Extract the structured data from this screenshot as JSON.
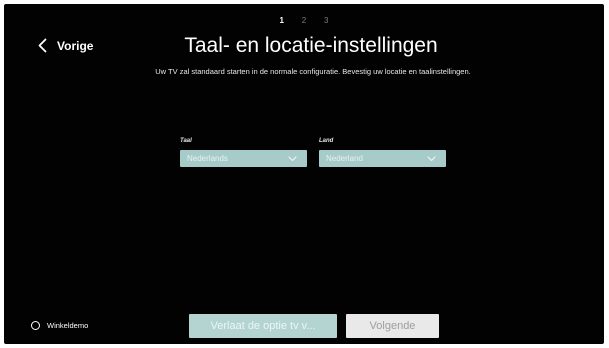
{
  "steps": {
    "items": [
      "1",
      "2",
      "3"
    ],
    "active_index": 0
  },
  "back": {
    "label": "Vorige",
    "icon": "chevron-left-icon"
  },
  "header": {
    "title": "Taal- en locatie-instellingen",
    "subtitle": "Uw TV zal standaard starten in de normale configuratie. Bevestig uw locatie en taalinstellingen."
  },
  "fields": {
    "taal": {
      "label": "Taal",
      "value": "Nederlands",
      "icon": "chevron-down-icon"
    },
    "land": {
      "label": "Land",
      "value": "Nederland",
      "icon": "chevron-down-icon"
    }
  },
  "footer": {
    "demo_label": "Winkeldemo",
    "exit_label": "Verlaat de optie tv v...",
    "next_label": "Volgende"
  },
  "colors": {
    "background": "#020202",
    "select_fill": "#a6cbc9",
    "exit_button": "#b4d4d1",
    "next_button": "#e9e9e9"
  }
}
